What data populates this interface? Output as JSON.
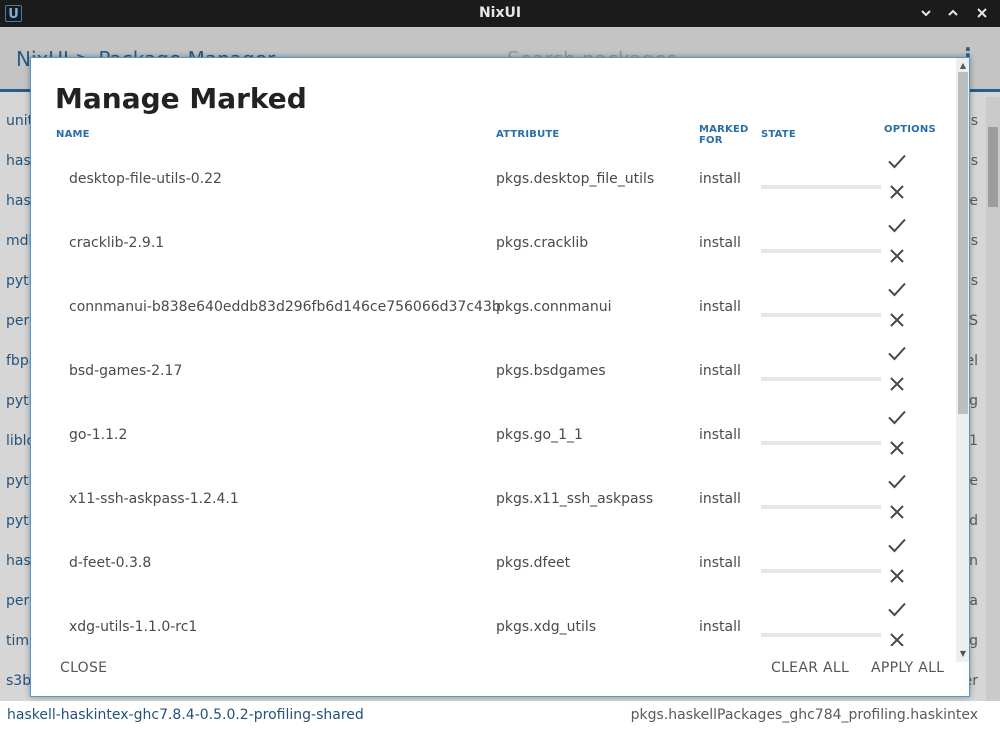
{
  "window": {
    "title": "NixUI",
    "icon": "U",
    "controls": [
      "chevron-down-icon",
      "chevron-up-icon",
      "close-icon"
    ]
  },
  "background": {
    "breadcrumb": "NixUI  >  Package Manager",
    "search_placeholder": "Search packages",
    "menu_icon": "⋮",
    "rows": [
      {
        "left": "unit",
        "right": "s"
      },
      {
        "left": "has",
        "right": "s"
      },
      {
        "left": "has",
        "right": "e"
      },
      {
        "left": "mdb",
        "right": "s"
      },
      {
        "left": "pyth",
        "right": "s"
      },
      {
        "left": "perl",
        "right": "S"
      },
      {
        "left": "fbpa",
        "right": "el"
      },
      {
        "left": "pyth",
        "right": "g"
      },
      {
        "left": "liblo",
        "right": "1"
      },
      {
        "left": "pyth",
        "right": "e"
      },
      {
        "left": "pyth",
        "right": "d"
      },
      {
        "left": "has",
        "right": "n"
      },
      {
        "left": "perl",
        "right": "a"
      },
      {
        "left": "timi",
        "right": "g"
      },
      {
        "left": "s3b",
        "right": "er"
      }
    ],
    "bottom_row": {
      "left": "haskell-haskintex-ghc7.8.4-0.5.0.2-profiling-shared",
      "right": "pkgs.haskellPackages_ghc784_profiling.haskintex"
    }
  },
  "dialog": {
    "title": "Manage Marked",
    "columns": {
      "name": "NAME",
      "attribute": "ATTRIBUTE",
      "marked_for": "MARKED FOR",
      "state": "STATE",
      "options": "OPTIONS"
    },
    "rows": [
      {
        "name": "desktop-file-utils-0.22",
        "attribute": "pkgs.desktop_file_utils",
        "marked_for": "install",
        "progress": 0
      },
      {
        "name": "cracklib-2.9.1",
        "attribute": "pkgs.cracklib",
        "marked_for": "install",
        "progress": 0
      },
      {
        "name": "connmanui-b838e640eddb83d296fb6d146ce756066d37c43b",
        "attribute": "pkgs.connmanui",
        "marked_for": "install",
        "progress": 0
      },
      {
        "name": "bsd-games-2.17",
        "attribute": "pkgs.bsdgames",
        "marked_for": "install",
        "progress": 0
      },
      {
        "name": "go-1.1.2",
        "attribute": "pkgs.go_1_1",
        "marked_for": "install",
        "progress": 0
      },
      {
        "name": "x11-ssh-askpass-1.2.4.1",
        "attribute": "pkgs.x11_ssh_askpass",
        "marked_for": "install",
        "progress": 0
      },
      {
        "name": "d-feet-0.3.8",
        "attribute": "pkgs.dfeet",
        "marked_for": "install",
        "progress": 0
      },
      {
        "name": "xdg-utils-1.1.0-rc1",
        "attribute": "pkgs.xdg_utils",
        "marked_for": "install",
        "progress": 0
      }
    ],
    "buttons": {
      "close": "CLOSE",
      "clear_all": "CLEAR ALL",
      "apply_all": "APPLY ALL"
    },
    "accent_color": "#2a6ea6"
  }
}
